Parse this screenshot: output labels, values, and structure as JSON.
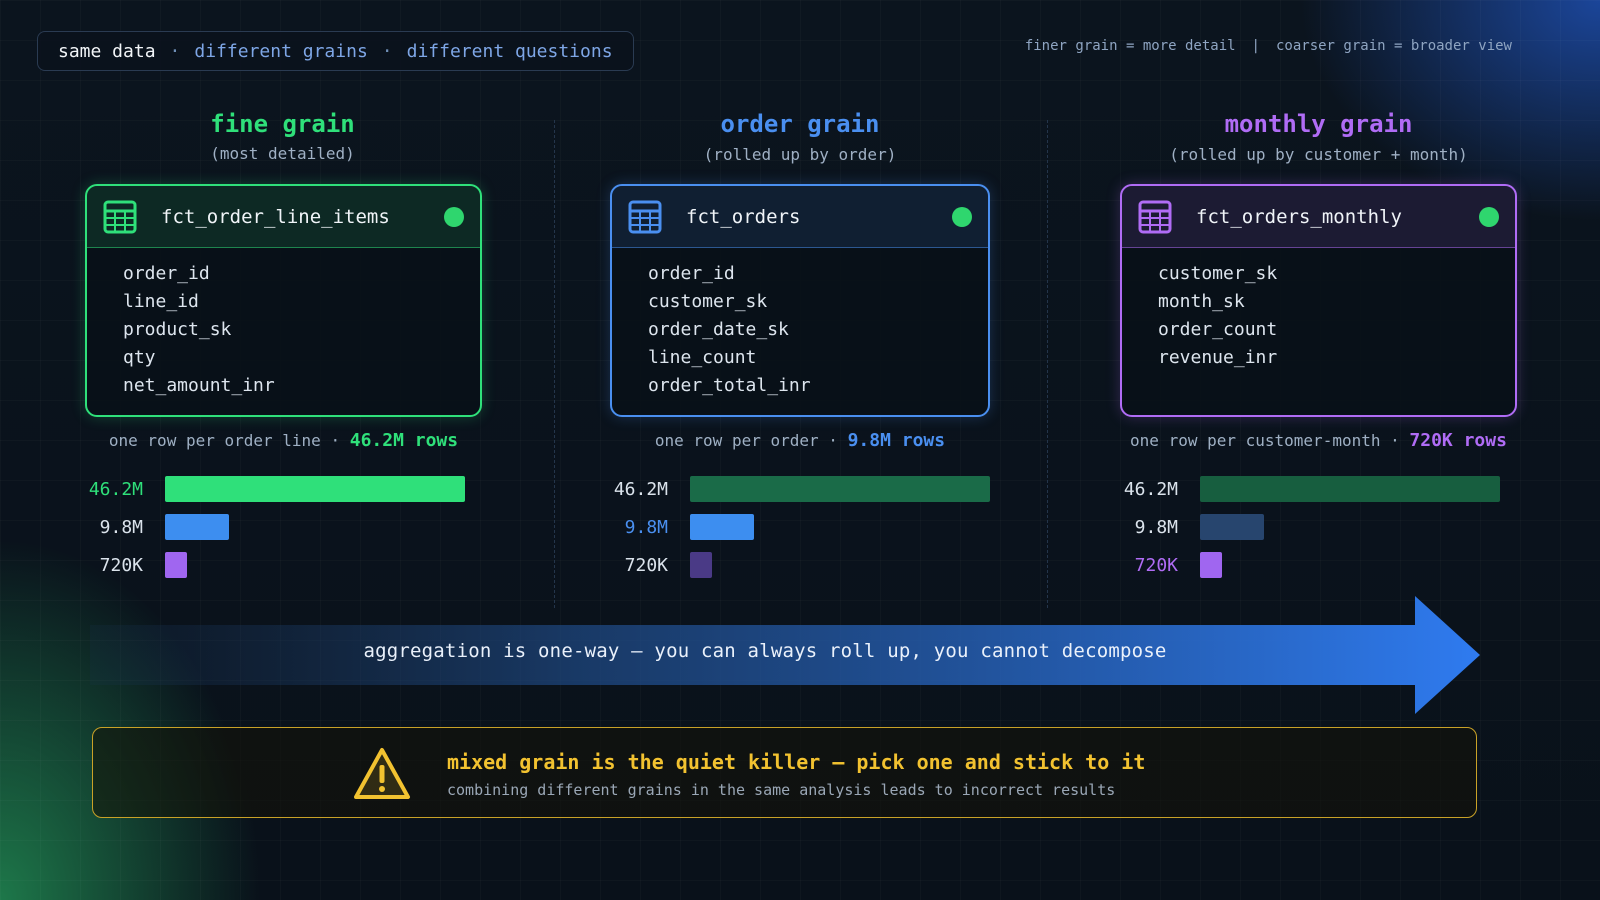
{
  "header": {
    "pill": [
      "same data",
      "different grains",
      "different questions"
    ],
    "pill_sep": "·",
    "legend_left": "finer grain = more detail",
    "legend_sep": "|",
    "legend_right": "coarser grain = broader view"
  },
  "columns": [
    {
      "title": "fine grain",
      "subtitle": "(most detailed)",
      "accent": "#2fe07a",
      "table_name": "fct_order_line_items",
      "fields": [
        "order_id",
        "line_id",
        "product_sk",
        "qty",
        "net_amount_inr"
      ],
      "row_desc": "one row per order line",
      "row_sep": "·",
      "row_count": "46.2M rows"
    },
    {
      "title": "order grain",
      "subtitle": "(rolled up by order)",
      "accent": "#4a8ff0",
      "table_name": "fct_orders",
      "fields": [
        "order_id",
        "customer_sk",
        "order_date_sk",
        "line_count",
        "order_total_inr"
      ],
      "row_desc": "one row per order",
      "row_sep": "·",
      "row_count": "9.8M rows"
    },
    {
      "title": "monthly grain",
      "subtitle": "(rolled up by customer + month)",
      "accent": "#b06cf5",
      "table_name": "fct_orders_monthly",
      "fields": [
        "customer_sk",
        "month_sk",
        "order_count",
        "revenue_inr"
      ],
      "row_desc": "one row per customer-month",
      "row_sep": "·",
      "row_count": "720K rows"
    }
  ],
  "chart_data": [
    {
      "type": "bar",
      "orientation": "horizontal",
      "highlight": "46.2M",
      "categories": [
        "46.2M",
        "9.8M",
        "720K"
      ],
      "values": [
        46200000,
        9800000,
        720000
      ],
      "colors": [
        "#2fe07a",
        "#3d8ef0",
        "#a066f0"
      ]
    },
    {
      "type": "bar",
      "orientation": "horizontal",
      "highlight": "9.8M",
      "categories": [
        "46.2M",
        "9.8M",
        "720K"
      ],
      "values": [
        46200000,
        9800000,
        720000
      ],
      "colors": [
        "#1a6b48",
        "#3d8ef0",
        "#4a3a86"
      ]
    },
    {
      "type": "bar",
      "orientation": "horizontal",
      "highlight": "720K",
      "categories": [
        "46.2M",
        "9.8M",
        "720K"
      ],
      "values": [
        46200000,
        9800000,
        720000
      ],
      "colors": [
        "#175e3f",
        "#27456e",
        "#a066f0"
      ]
    }
  ],
  "arrow": {
    "text": "aggregation is one-way — you can always roll up, you cannot decompose"
  },
  "warning": {
    "icon": "warning-triangle-icon",
    "title": "mixed grain is the quiet killer — pick one and stick to it",
    "subtitle": "combining different grains in the same analysis leads to incorrect results",
    "color": "#f2c230"
  }
}
